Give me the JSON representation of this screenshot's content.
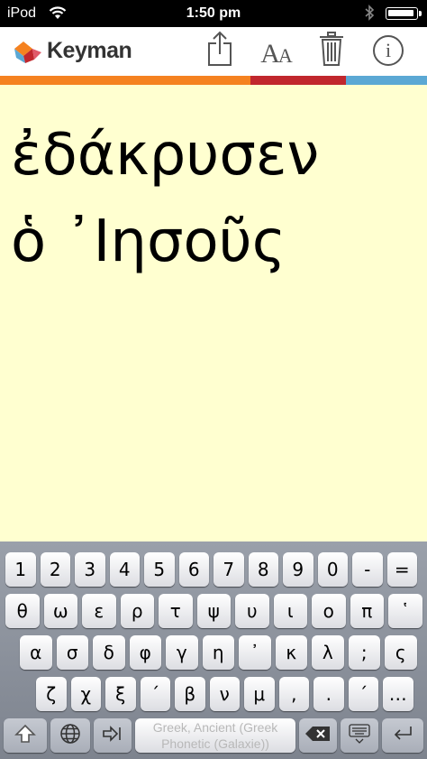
{
  "status_bar": {
    "carrier": "iPod",
    "time": "1:50 pm"
  },
  "nav": {
    "brand": "Keyman",
    "tools": [
      "share-icon",
      "font-size-icon",
      "trash-icon",
      "info-icon"
    ],
    "font_button_label": "AA",
    "info_label": "i"
  },
  "colors": {
    "orange": "#f58220",
    "red": "#c1272d",
    "blue": "#5ba8d4",
    "editor_bg": "#ffffd0"
  },
  "editor": {
    "text": "ἐδάκρυσεν\nὁ ᾿Ιησοῦς"
  },
  "keyboard": {
    "row1": [
      "1",
      "2",
      "3",
      "4",
      "5",
      "6",
      "7",
      "8",
      "9",
      "0",
      "-",
      "="
    ],
    "row2": [
      "θ",
      "ω",
      "ε",
      "ρ",
      "τ",
      "ψ",
      "υ",
      "ι",
      "ο",
      "π",
      "῾"
    ],
    "row3": [
      "α",
      "σ",
      "δ",
      "φ",
      "γ",
      "η",
      "᾿",
      "κ",
      "λ",
      ";",
      "ς"
    ],
    "row4": [
      "ζ",
      "χ",
      "ξ",
      "΄",
      "β",
      "ν",
      "μ",
      ",",
      ".",
      "΄",
      "…"
    ],
    "space_label": "Greek, Ancient (Greek Phonetic (Galaxie))",
    "special_keys": [
      "shift-icon",
      "globe-icon",
      "tab-icon",
      "backspace-icon",
      "hide-keyboard-icon",
      "enter-icon"
    ]
  }
}
